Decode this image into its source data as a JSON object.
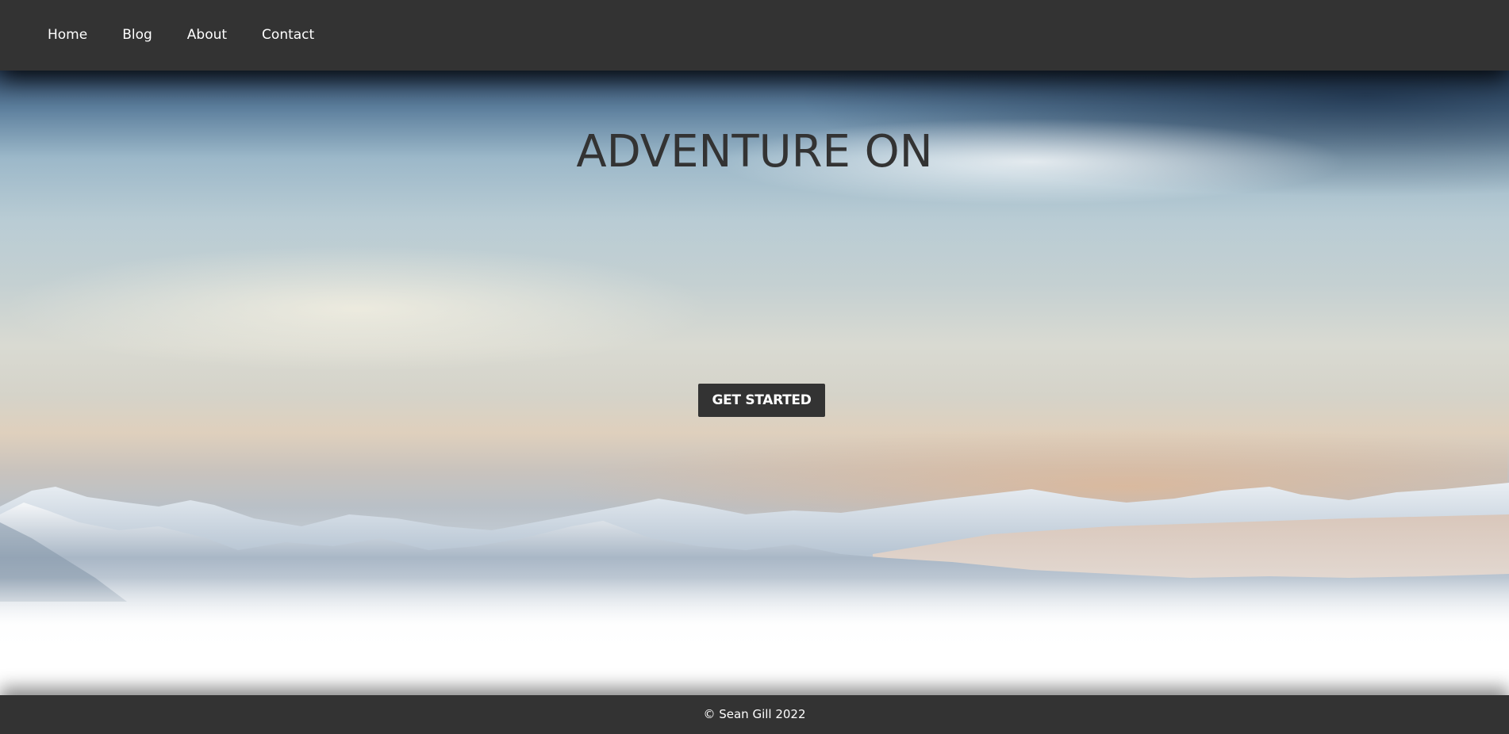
{
  "nav": {
    "items": [
      {
        "label": "Home"
      },
      {
        "label": "Blog"
      },
      {
        "label": "About"
      },
      {
        "label": "Contact"
      }
    ]
  },
  "hero": {
    "title": "ADVENTURE ON",
    "cta_label": "GET STARTED"
  },
  "footer": {
    "text": "© Sean Gill 2022"
  },
  "colors": {
    "bar": "#333333",
    "text_on_bar": "#ffffff",
    "title": "#333333"
  }
}
